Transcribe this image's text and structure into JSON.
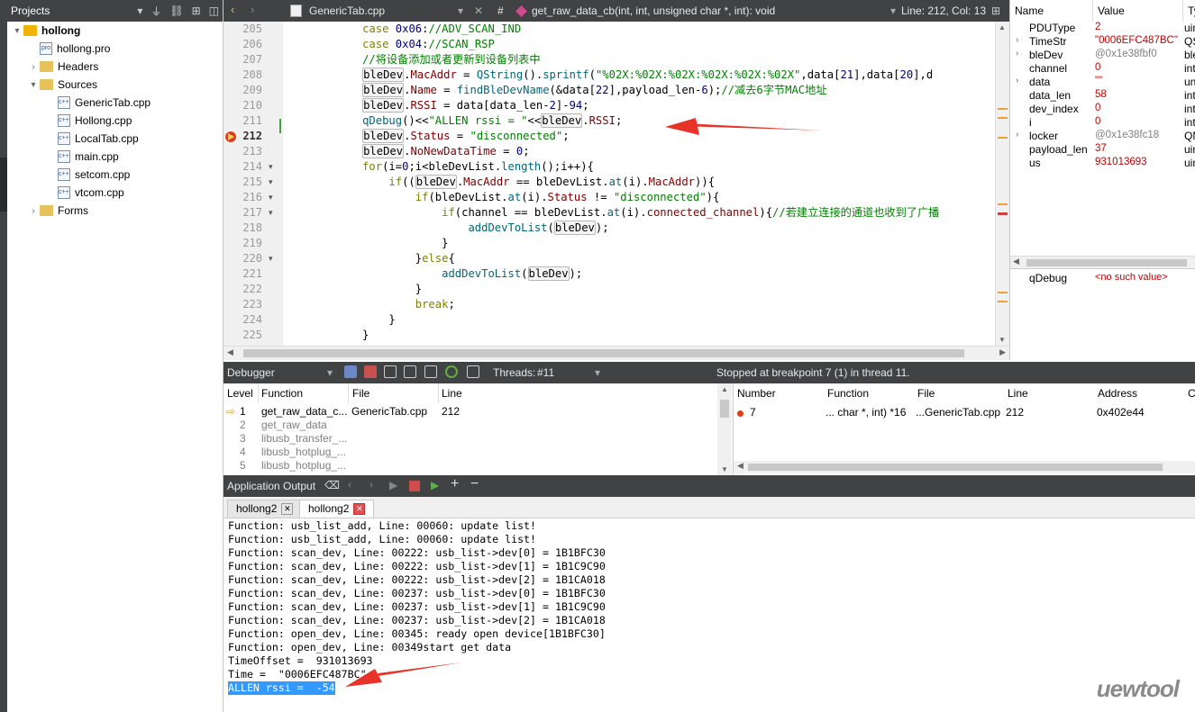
{
  "projects": {
    "header": "Projects",
    "tree": [
      {
        "label": "hollong",
        "kind": "project"
      },
      {
        "label": "hollong.pro",
        "kind": "pro"
      },
      {
        "label": "Headers",
        "kind": "folder"
      },
      {
        "label": "Sources",
        "kind": "folder"
      },
      {
        "label": "GenericTab.cpp",
        "kind": "cpp"
      },
      {
        "label": "Hollong.cpp",
        "kind": "cpp"
      },
      {
        "label": "LocalTab.cpp",
        "kind": "cpp"
      },
      {
        "label": "main.cpp",
        "kind": "cpp"
      },
      {
        "label": "setcom.cpp",
        "kind": "cpp"
      },
      {
        "label": "vtcom.cpp",
        "kind": "cpp"
      },
      {
        "label": "Forms",
        "kind": "folder"
      }
    ]
  },
  "editor": {
    "file": "GenericTab.cpp",
    "hash": "#",
    "function": "get_raw_data_cb(int, int, unsigned char *, int): void",
    "position": "Line: 212, Col: 13",
    "line_numbers": [
      "205",
      "206",
      "207",
      "208",
      "209",
      "210",
      "211",
      "212",
      "213",
      "214",
      "215",
      "216",
      "217",
      "218",
      "219",
      "220",
      "221",
      "222",
      "223",
      "224",
      "225"
    ],
    "code": [
      "            case 0x06://ADV_SCAN_IND",
      "            case 0x04://SCAN_RSP",
      "            //将设备添加或者更新到设备列表中",
      "            bleDev.MacAddr = QString().sprintf(\"%02X:%02X:%02X:%02X:%02X:%02X\",data[21],data[20],d",
      "            bleDev.Name = findBleDevName(&data[22],payload_len-6);//减去6字节MAC地址",
      "            bleDev.RSSI = data[data_len-2]-94;",
      "            qDebug()<<\"ALLEN rssi = \"<<bleDev.RSSI;",
      "            bleDev.Status = \"disconnected\";",
      "            bleDev.NoNewDataTime = 0;",
      "            for(i=0;i<bleDevList.length();i++){",
      "                if((bleDev.MacAddr == bleDevList.at(i).MacAddr)){",
      "                    if(bleDevList.at(i).Status != \"disconnected\"){",
      "                        if(channel == bleDevList.at(i).connected_channel){//若建立连接的通道也收到了广播",
      "                            addDevToList(bleDev);",
      "                        }",
      "                    }else{",
      "                        addDevToList(bleDev);",
      "                    }",
      "                    break;",
      "                }",
      "            }"
    ]
  },
  "locals": {
    "headers": [
      "Name",
      "Value",
      "Ty"
    ],
    "rows": [
      {
        "name": "PDUType",
        "value": "2",
        "type": "uin",
        "expand": false,
        "red": true
      },
      {
        "name": "TimeStr",
        "value": "\"0006EFC487BC\"",
        "type": "QS",
        "expand": true,
        "red": true
      },
      {
        "name": "bleDev",
        "value": "@0x1e38fbf0",
        "type": "ble",
        "expand": true,
        "red": false
      },
      {
        "name": "channel",
        "value": "0",
        "type": "int",
        "expand": false,
        "red": true
      },
      {
        "name": "data",
        "value": "\"\"",
        "type": "un",
        "expand": true,
        "red": true
      },
      {
        "name": "data_len",
        "value": "58",
        "type": "int",
        "expand": false,
        "red": true
      },
      {
        "name": "dev_index",
        "value": "0",
        "type": "int",
        "expand": false,
        "red": true
      },
      {
        "name": "i",
        "value": "0",
        "type": "int",
        "expand": false,
        "red": true
      },
      {
        "name": "locker",
        "value": "@0x1e38fc18",
        "type": "QM",
        "expand": true,
        "red": false
      },
      {
        "name": "payload_len",
        "value": "37",
        "type": "uin",
        "expand": false,
        "red": true
      },
      {
        "name": "us",
        "value": "931013693",
        "type": "uin",
        "expand": false,
        "red": true
      }
    ],
    "watch_name": "qDebug",
    "watch_value": "<no such value>"
  },
  "debugger": {
    "title": "Debugger",
    "threads_label": "Threads:",
    "thread": "#11",
    "status": "Stopped at breakpoint 7 (1) in thread 11."
  },
  "stack": {
    "headers": [
      "Level",
      "Function",
      "File",
      "Line"
    ],
    "rows": [
      {
        "level": "1",
        "function": "get_raw_data_c...",
        "file": "GenericTab.cpp",
        "line": "212",
        "current": true
      },
      {
        "level": "2",
        "function": "get_raw_data",
        "file": "",
        "line": "",
        "current": false
      },
      {
        "level": "3",
        "function": "libusb_transfer_...",
        "file": "",
        "line": "",
        "current": false
      },
      {
        "level": "4",
        "function": "libusb_hotplug_...",
        "file": "",
        "line": "",
        "current": false
      },
      {
        "level": "5",
        "function": "libusb_hotplug_...",
        "file": "",
        "line": "",
        "current": false
      }
    ]
  },
  "breakpoints": {
    "headers": [
      "Number",
      "Function",
      "File",
      "Line",
      "Address",
      "C"
    ],
    "rows": [
      {
        "number": "7",
        "function": "... char *, int) *16",
        "file": "...GenericTab.cpp",
        "line": "212",
        "address": "0x402e44"
      }
    ]
  },
  "app_output": {
    "title": "Application Output",
    "tabs": [
      "hollong2",
      "hollong2"
    ],
    "lines": [
      "Function: usb_list_add, Line: 00060: update list!",
      "Function: usb_list_add, Line: 00060: update list!",
      "Function: scan_dev, Line: 00222: usb_list->dev[0] = 1B1BFC30",
      "Function: scan_dev, Line: 00222: usb_list->dev[1] = 1B1C9C90",
      "Function: scan_dev, Line: 00222: usb_list->dev[2] = 1B1CA018",
      "Function: scan_dev, Line: 00237: usb_list->dev[0] = 1B1BFC30",
      "Function: scan_dev, Line: 00237: usb_list->dev[1] = 1B1C9C90",
      "Function: scan_dev, Line: 00237: usb_list->dev[2] = 1B1CA018",
      "Function: open_dev, Line: 00345: ready open device[1B1BFC30]",
      "Function: open_dev, Line: 00349start get data",
      "TimeOffset =  931013693",
      "Time =  \"0006EFC487BC\""
    ],
    "highlighted_line": "ALLEN rssi =  -54"
  },
  "watermark": "uewtool",
  "colors": {
    "panel_dark": "#404244",
    "breakpoint": "#d9411e",
    "arrow": "#e8332a",
    "selection": "#3399ff"
  }
}
